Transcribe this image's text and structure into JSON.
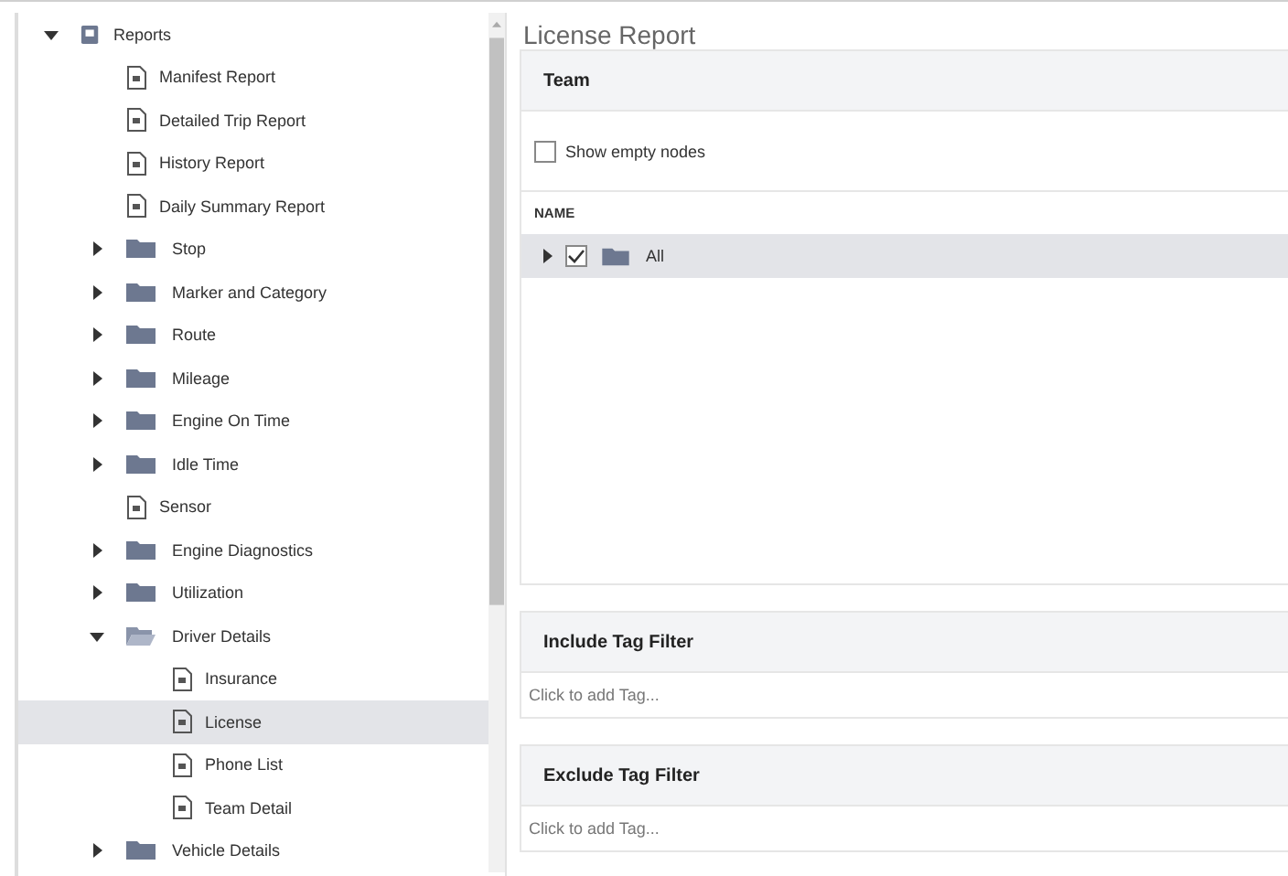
{
  "sidebar": {
    "tree": [
      {
        "label": "Reports",
        "kind": "module",
        "expanded": true,
        "selected": false,
        "children": [
          {
            "label": "Manifest Report",
            "kind": "report",
            "selected": false
          },
          {
            "label": "Detailed Trip Report",
            "kind": "report",
            "selected": false
          },
          {
            "label": "History Report",
            "kind": "report",
            "selected": false
          },
          {
            "label": "Daily Summary Report",
            "kind": "report",
            "selected": false
          },
          {
            "label": "Stop",
            "kind": "folder",
            "expanded": false,
            "selected": false
          },
          {
            "label": "Marker and Category",
            "kind": "folder",
            "expanded": false,
            "selected": false
          },
          {
            "label": "Route",
            "kind": "folder",
            "expanded": false,
            "selected": false
          },
          {
            "label": "Mileage",
            "kind": "folder",
            "expanded": false,
            "selected": false
          },
          {
            "label": "Engine On Time",
            "kind": "folder",
            "expanded": false,
            "selected": false
          },
          {
            "label": "Idle Time",
            "kind": "folder",
            "expanded": false,
            "selected": false
          },
          {
            "label": "Sensor",
            "kind": "report",
            "selected": false
          },
          {
            "label": "Engine Diagnostics",
            "kind": "folder",
            "expanded": false,
            "selected": false
          },
          {
            "label": "Utilization",
            "kind": "folder",
            "expanded": false,
            "selected": false
          },
          {
            "label": "Driver Details",
            "kind": "folder",
            "expanded": true,
            "selected": false,
            "children": [
              {
                "label": "Insurance",
                "kind": "report",
                "selected": false
              },
              {
                "label": "License",
                "kind": "report",
                "selected": true
              },
              {
                "label": "Phone List",
                "kind": "report",
                "selected": false
              },
              {
                "label": "Team Detail",
                "kind": "report",
                "selected": false
              }
            ]
          },
          {
            "label": "Vehicle Details",
            "kind": "folder",
            "expanded": false,
            "selected": false
          }
        ]
      }
    ]
  },
  "report": {
    "title": "License Report",
    "team": {
      "title": "Team",
      "show_empty_nodes": {
        "label": "Show empty nodes",
        "checked": false
      },
      "column": "NAME",
      "tree": [
        {
          "label": "All",
          "expanded": false,
          "checked": true,
          "selected": true
        }
      ]
    },
    "include_filter": {
      "title": "Include Tag Filter",
      "placeholder": "Click to add Tag..."
    },
    "exclude_filter": {
      "title": "Exclude Tag Filter",
      "placeholder": "Click to add Tag..."
    }
  }
}
